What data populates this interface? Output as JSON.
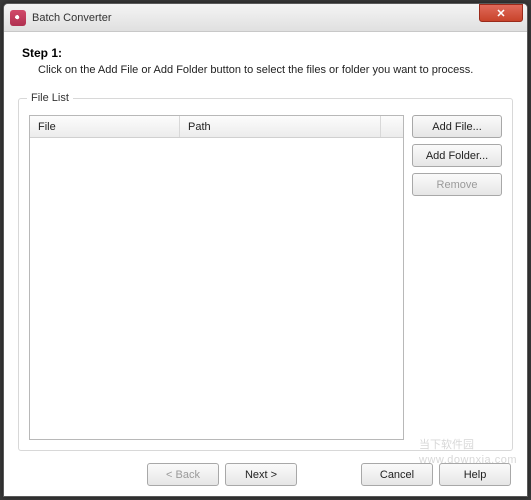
{
  "window": {
    "title": "Batch Converter",
    "close_glyph": "✕"
  },
  "step": {
    "title": "Step 1:",
    "description": "Click on the Add File or Add Folder button to select the files or folder you want to process."
  },
  "file_list": {
    "group_label": "File List",
    "columns": {
      "file": "File",
      "path": "Path"
    },
    "rows": []
  },
  "side_buttons": {
    "add_file": "Add File...",
    "add_folder": "Add Folder...",
    "remove": "Remove"
  },
  "footer": {
    "back": "< Back",
    "next": "Next >",
    "cancel": "Cancel",
    "help": "Help"
  },
  "watermark": {
    "line1": "当下软件园",
    "line2": "www.downxia.com"
  }
}
